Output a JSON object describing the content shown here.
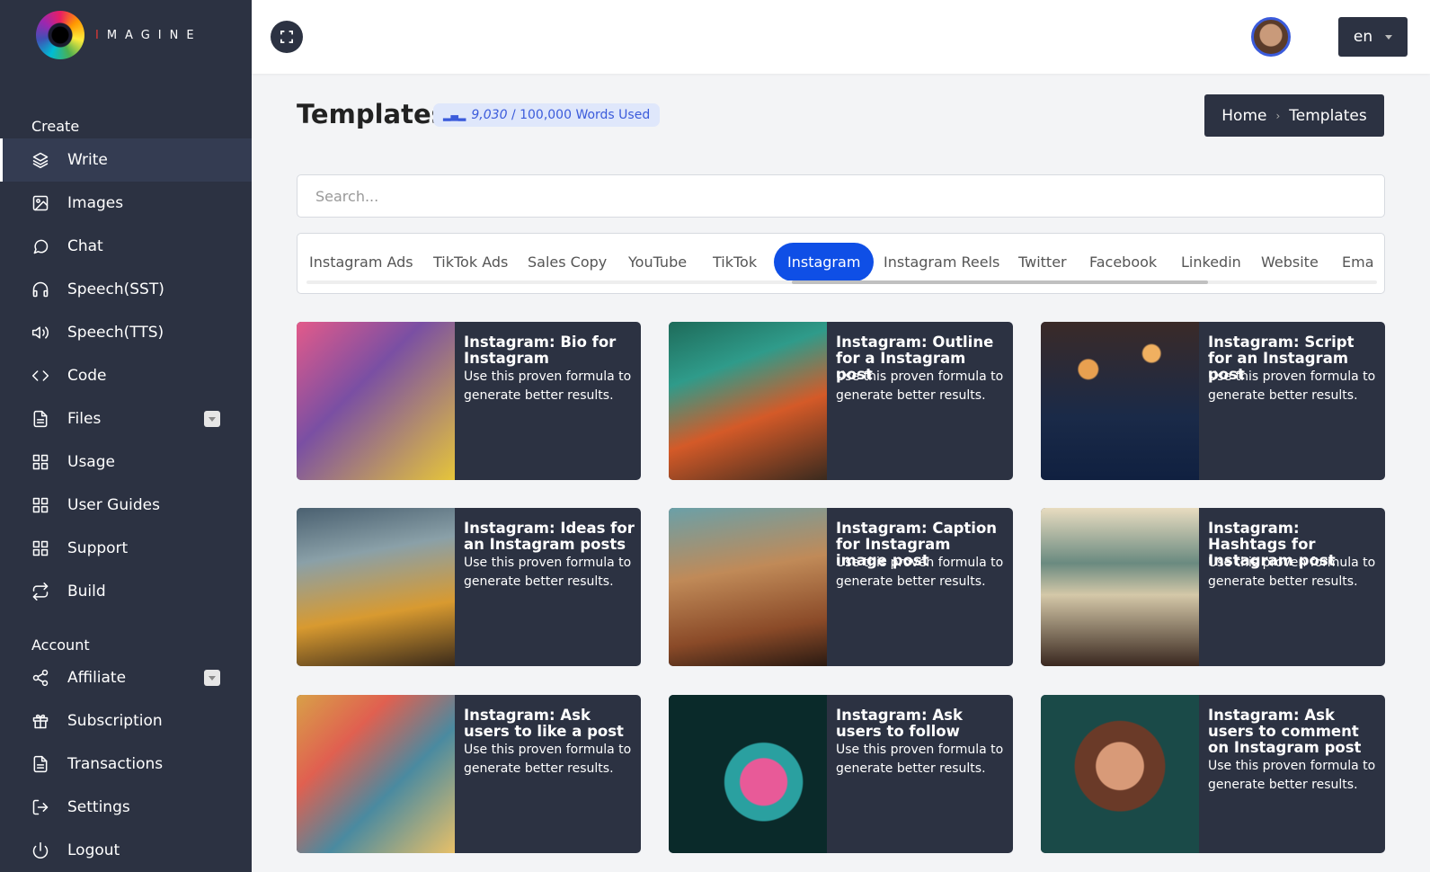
{
  "brand": {
    "name_first": "I",
    "name_rest": "MAGINE"
  },
  "sidebar": {
    "create_label": "Create",
    "account_label": "Account",
    "items": [
      {
        "label": "Write",
        "icon": "layers-icon"
      },
      {
        "label": "Images",
        "icon": "image-icon"
      },
      {
        "label": "Chat",
        "icon": "chat-icon"
      },
      {
        "label": "Speech(SST)",
        "icon": "headphones-icon"
      },
      {
        "label": "Speech(TTS)",
        "icon": "speaker-icon"
      },
      {
        "label": "Code",
        "icon": "code-icon"
      },
      {
        "label": "Files",
        "icon": "file-icon"
      },
      {
        "label": "Usage",
        "icon": "grid-icon"
      },
      {
        "label": "User Guides",
        "icon": "grid-icon"
      },
      {
        "label": "Support",
        "icon": "grid-icon"
      },
      {
        "label": "Build",
        "icon": "repeat-icon"
      }
    ],
    "account_items": [
      {
        "label": "Affiliate",
        "icon": "share-icon"
      },
      {
        "label": "Subscription",
        "icon": "gift-icon"
      },
      {
        "label": "Transactions",
        "icon": "file-icon"
      },
      {
        "label": "Settings",
        "icon": "logout-arrow-icon"
      },
      {
        "label": "Logout",
        "icon": "power-icon"
      }
    ]
  },
  "topbar": {
    "language": "en"
  },
  "page": {
    "title": "Templates",
    "words_used": "9,030",
    "words_total": "/ 100,000 Words Used"
  },
  "breadcrumb": {
    "home": "Home",
    "current": "Templates"
  },
  "search": {
    "placeholder": "Search..."
  },
  "tabs": [
    "Instagram Ads",
    "TikTok Ads",
    "Sales Copy",
    "YouTube",
    "TikTok",
    "Instagram",
    "Instagram Reels",
    "Twitter",
    "Facebook",
    "Linkedin",
    "Website",
    "Ema"
  ],
  "active_tab": "Instagram",
  "card_desc": "Use this proven formula to generate better results.",
  "cards": [
    {
      "title": "Instagram: Bio for Instagram"
    },
    {
      "title": "Instagram: Outline for a Instagram post"
    },
    {
      "title": "Instagram: Script for an Instagram post"
    },
    {
      "title": "Instagram: Ideas for an Instagram posts"
    },
    {
      "title": "Instagram: Caption for Instagram image post"
    },
    {
      "title": "Instagram: Hashtags for Instagram post"
    },
    {
      "title": "Instagram: Ask users to like a post"
    },
    {
      "title": "Instagram: Ask users to follow"
    },
    {
      "title": "Instagram: Ask users to comment on Instagram post"
    }
  ],
  "colors": {
    "sidebar": "#2c3242",
    "accent": "#0f4fe6",
    "badge_bg": "#dfe7fb"
  }
}
